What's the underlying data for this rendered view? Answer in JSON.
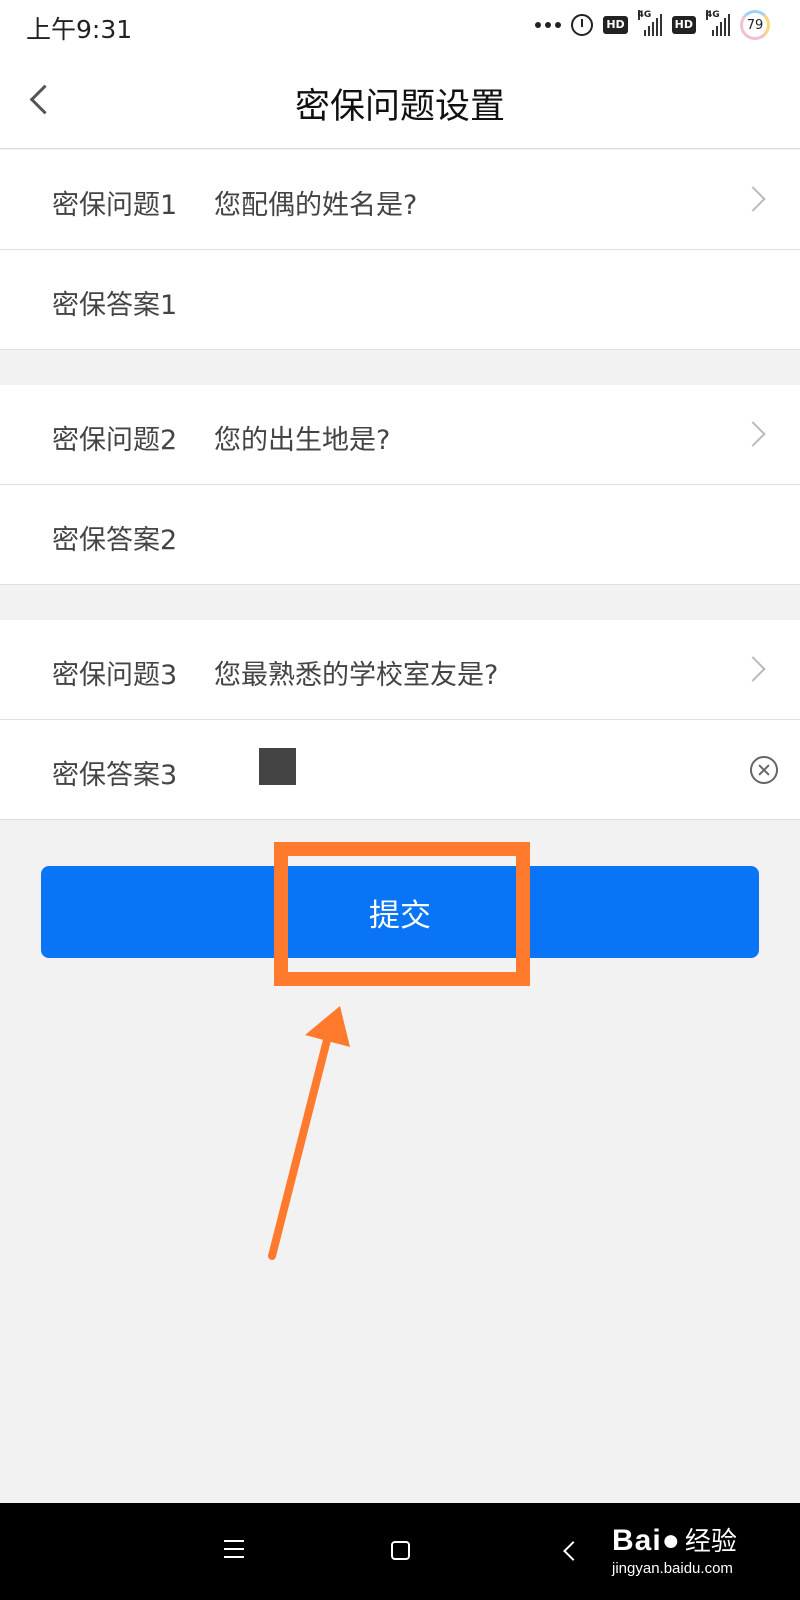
{
  "status_bar": {
    "time": "上午9:31",
    "network_1": "4G",
    "network_2": "4G",
    "hd_1": "HD",
    "hd_2": "HD",
    "battery": "79"
  },
  "header": {
    "title": "密保问题设置"
  },
  "questions": [
    {
      "question_label": "密保问题1",
      "question_value": "您配偶的姓名是?",
      "answer_label": "密保答案1",
      "answer_value": ""
    },
    {
      "question_label": "密保问题2",
      "question_value": "您的出生地是?",
      "answer_label": "密保答案2",
      "answer_value": ""
    },
    {
      "question_label": "密保问题3",
      "question_value": "您最熟悉的学校室友是?",
      "answer_label": "密保答案3",
      "answer_value": ""
    }
  ],
  "submit_label": "提交",
  "watermark": {
    "brand": "Bai",
    "brand_cn": "经验",
    "url": "jingyan.baidu.com"
  },
  "colors": {
    "primary_button": "#0a74f7",
    "annotation": "#ff7a2c"
  }
}
